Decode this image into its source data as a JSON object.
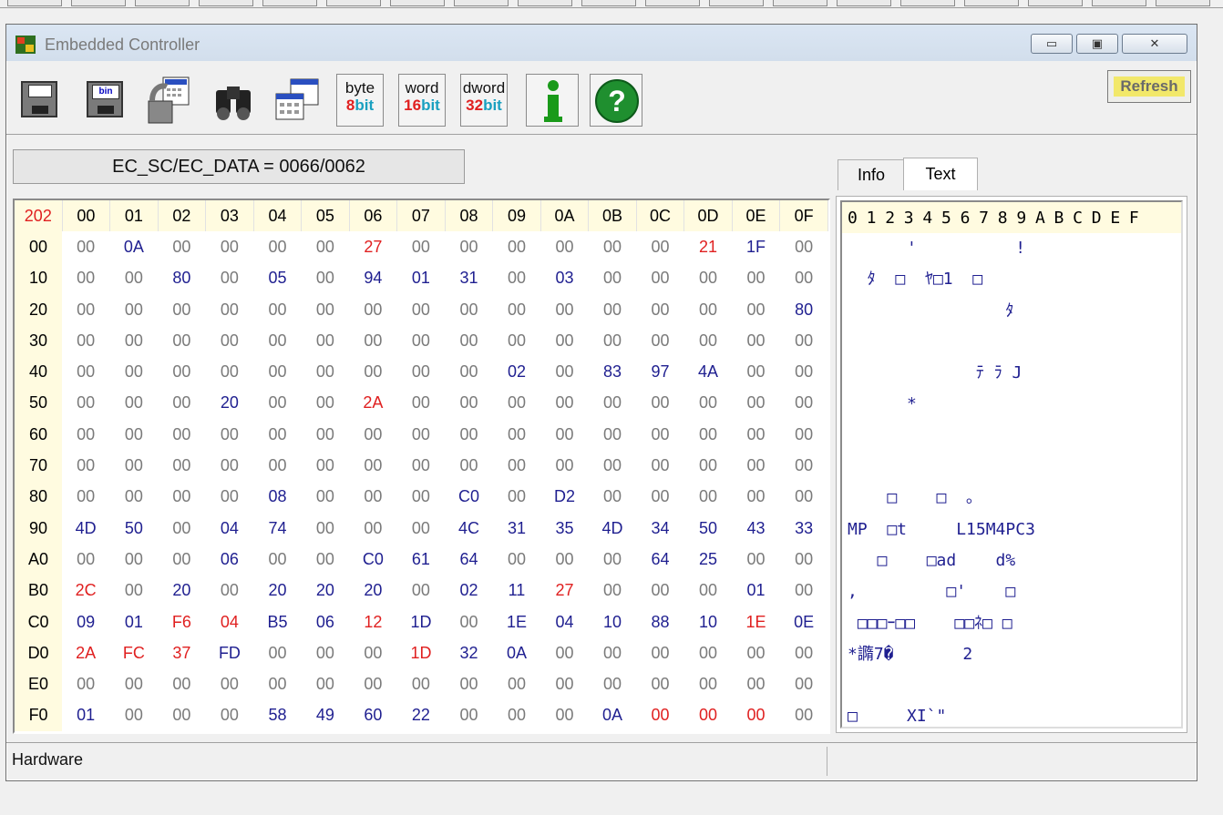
{
  "window": {
    "title": "Embedded Controller"
  },
  "toolbar": {
    "size_buttons": [
      {
        "top": "byte",
        "num": "8",
        "unit": "bit"
      },
      {
        "top": "word",
        "num": "16",
        "unit": "bit"
      },
      {
        "top": "dword",
        "num": "32",
        "unit": "bit"
      }
    ],
    "refresh_label": "Refresh"
  },
  "port_label": "EC_SC/EC_DATA = 0066/0062",
  "hex": {
    "corner": "202",
    "columns": [
      "00",
      "01",
      "02",
      "03",
      "04",
      "05",
      "06",
      "07",
      "08",
      "09",
      "0A",
      "0B",
      "0C",
      "0D",
      "0E",
      "0F"
    ],
    "rows": [
      {
        "addr": "00",
        "cells": [
          "00",
          "0A",
          "00",
          "00",
          "00",
          "00",
          "27",
          "00",
          "00",
          "00",
          "00",
          "00",
          "00",
          "21",
          "1F",
          "00"
        ]
      },
      {
        "addr": "10",
        "cells": [
          "00",
          "00",
          "80",
          "00",
          "05",
          "00",
          "94",
          "01",
          "31",
          "00",
          "03",
          "00",
          "00",
          "00",
          "00",
          "00"
        ]
      },
      {
        "addr": "20",
        "cells": [
          "00",
          "00",
          "00",
          "00",
          "00",
          "00",
          "00",
          "00",
          "00",
          "00",
          "00",
          "00",
          "00",
          "00",
          "00",
          "80"
        ]
      },
      {
        "addr": "30",
        "cells": [
          "00",
          "00",
          "00",
          "00",
          "00",
          "00",
          "00",
          "00",
          "00",
          "00",
          "00",
          "00",
          "00",
          "00",
          "00",
          "00"
        ]
      },
      {
        "addr": "40",
        "cells": [
          "00",
          "00",
          "00",
          "00",
          "00",
          "00",
          "00",
          "00",
          "00",
          "02",
          "00",
          "83",
          "97",
          "4A",
          "00",
          "00"
        ]
      },
      {
        "addr": "50",
        "cells": [
          "00",
          "00",
          "00",
          "20",
          "00",
          "00",
          "2A",
          "00",
          "00",
          "00",
          "00",
          "00",
          "00",
          "00",
          "00",
          "00"
        ]
      },
      {
        "addr": "60",
        "cells": [
          "00",
          "00",
          "00",
          "00",
          "00",
          "00",
          "00",
          "00",
          "00",
          "00",
          "00",
          "00",
          "00",
          "00",
          "00",
          "00"
        ]
      },
      {
        "addr": "70",
        "cells": [
          "00",
          "00",
          "00",
          "00",
          "00",
          "00",
          "00",
          "00",
          "00",
          "00",
          "00",
          "00",
          "00",
          "00",
          "00",
          "00"
        ]
      },
      {
        "addr": "80",
        "cells": [
          "00",
          "00",
          "00",
          "00",
          "08",
          "00",
          "00",
          "00",
          "C0",
          "00",
          "D2",
          "00",
          "00",
          "00",
          "00",
          "00"
        ]
      },
      {
        "addr": "90",
        "cells": [
          "4D",
          "50",
          "00",
          "04",
          "74",
          "00",
          "00",
          "00",
          "4C",
          "31",
          "35",
          "4D",
          "34",
          "50",
          "43",
          "33"
        ]
      },
      {
        "addr": "A0",
        "cells": [
          "00",
          "00",
          "00",
          "06",
          "00",
          "00",
          "C0",
          "61",
          "64",
          "00",
          "00",
          "00",
          "64",
          "25",
          "00",
          "00"
        ]
      },
      {
        "addr": "B0",
        "cells": [
          "2C",
          "00",
          "20",
          "00",
          "20",
          "20",
          "20",
          "00",
          "02",
          "11",
          "27",
          "00",
          "00",
          "00",
          "01",
          "00"
        ]
      },
      {
        "addr": "C0",
        "cells": [
          "09",
          "01",
          "F6",
          "04",
          "B5",
          "06",
          "12",
          "1D",
          "00",
          "1E",
          "04",
          "10",
          "88",
          "10",
          "1E",
          "0E"
        ]
      },
      {
        "addr": "D0",
        "cells": [
          "2A",
          "FC",
          "37",
          "FD",
          "00",
          "00",
          "00",
          "1D",
          "32",
          "0A",
          "00",
          "00",
          "00",
          "00",
          "00",
          "00"
        ]
      },
      {
        "addr": "E0",
        "cells": [
          "00",
          "00",
          "00",
          "00",
          "00",
          "00",
          "00",
          "00",
          "00",
          "00",
          "00",
          "00",
          "00",
          "00",
          "00",
          "00"
        ]
      },
      {
        "addr": "F0",
        "cells": [
          "01",
          "00",
          "00",
          "00",
          "58",
          "49",
          "60",
          "22",
          "00",
          "00",
          "00",
          "0A",
          "00",
          "00",
          "00",
          "00"
        ]
      }
    ],
    "red_cells": {
      "00": [
        6,
        13
      ],
      "50": [
        6
      ],
      "B0": [
        0,
        10
      ],
      "C0": [
        2,
        3,
        6,
        14
      ],
      "D0": [
        0,
        1,
        2,
        7
      ],
      "F0": [
        12,
        13,
        14
      ]
    }
  },
  "tabs": {
    "info": "Info",
    "text": "Text"
  },
  "text_view": {
    "header": [
      "0",
      "1",
      "2",
      "3",
      "4",
      "5",
      "6",
      "7",
      "8",
      "9",
      "A",
      "B",
      "C",
      "D",
      "E",
      "F"
    ],
    "lines": [
      "      '          !",
      "  ﾀ  □  ﾔ□1  □",
      "                ﾀ",
      "",
      "             ﾃ ﾗ J",
      "      *",
      "",
      "",
      "    □    □  ｡",
      "MP  □t     L15M4PC3",
      "   □    □ad    d%",
      ",         □'    □",
      " □□□ｰ□□    □□ﾈ□ □",
      "*䜏7�       2",
      "",
      "□     XI`\""
    ]
  },
  "status": {
    "left": "Hardware"
  }
}
